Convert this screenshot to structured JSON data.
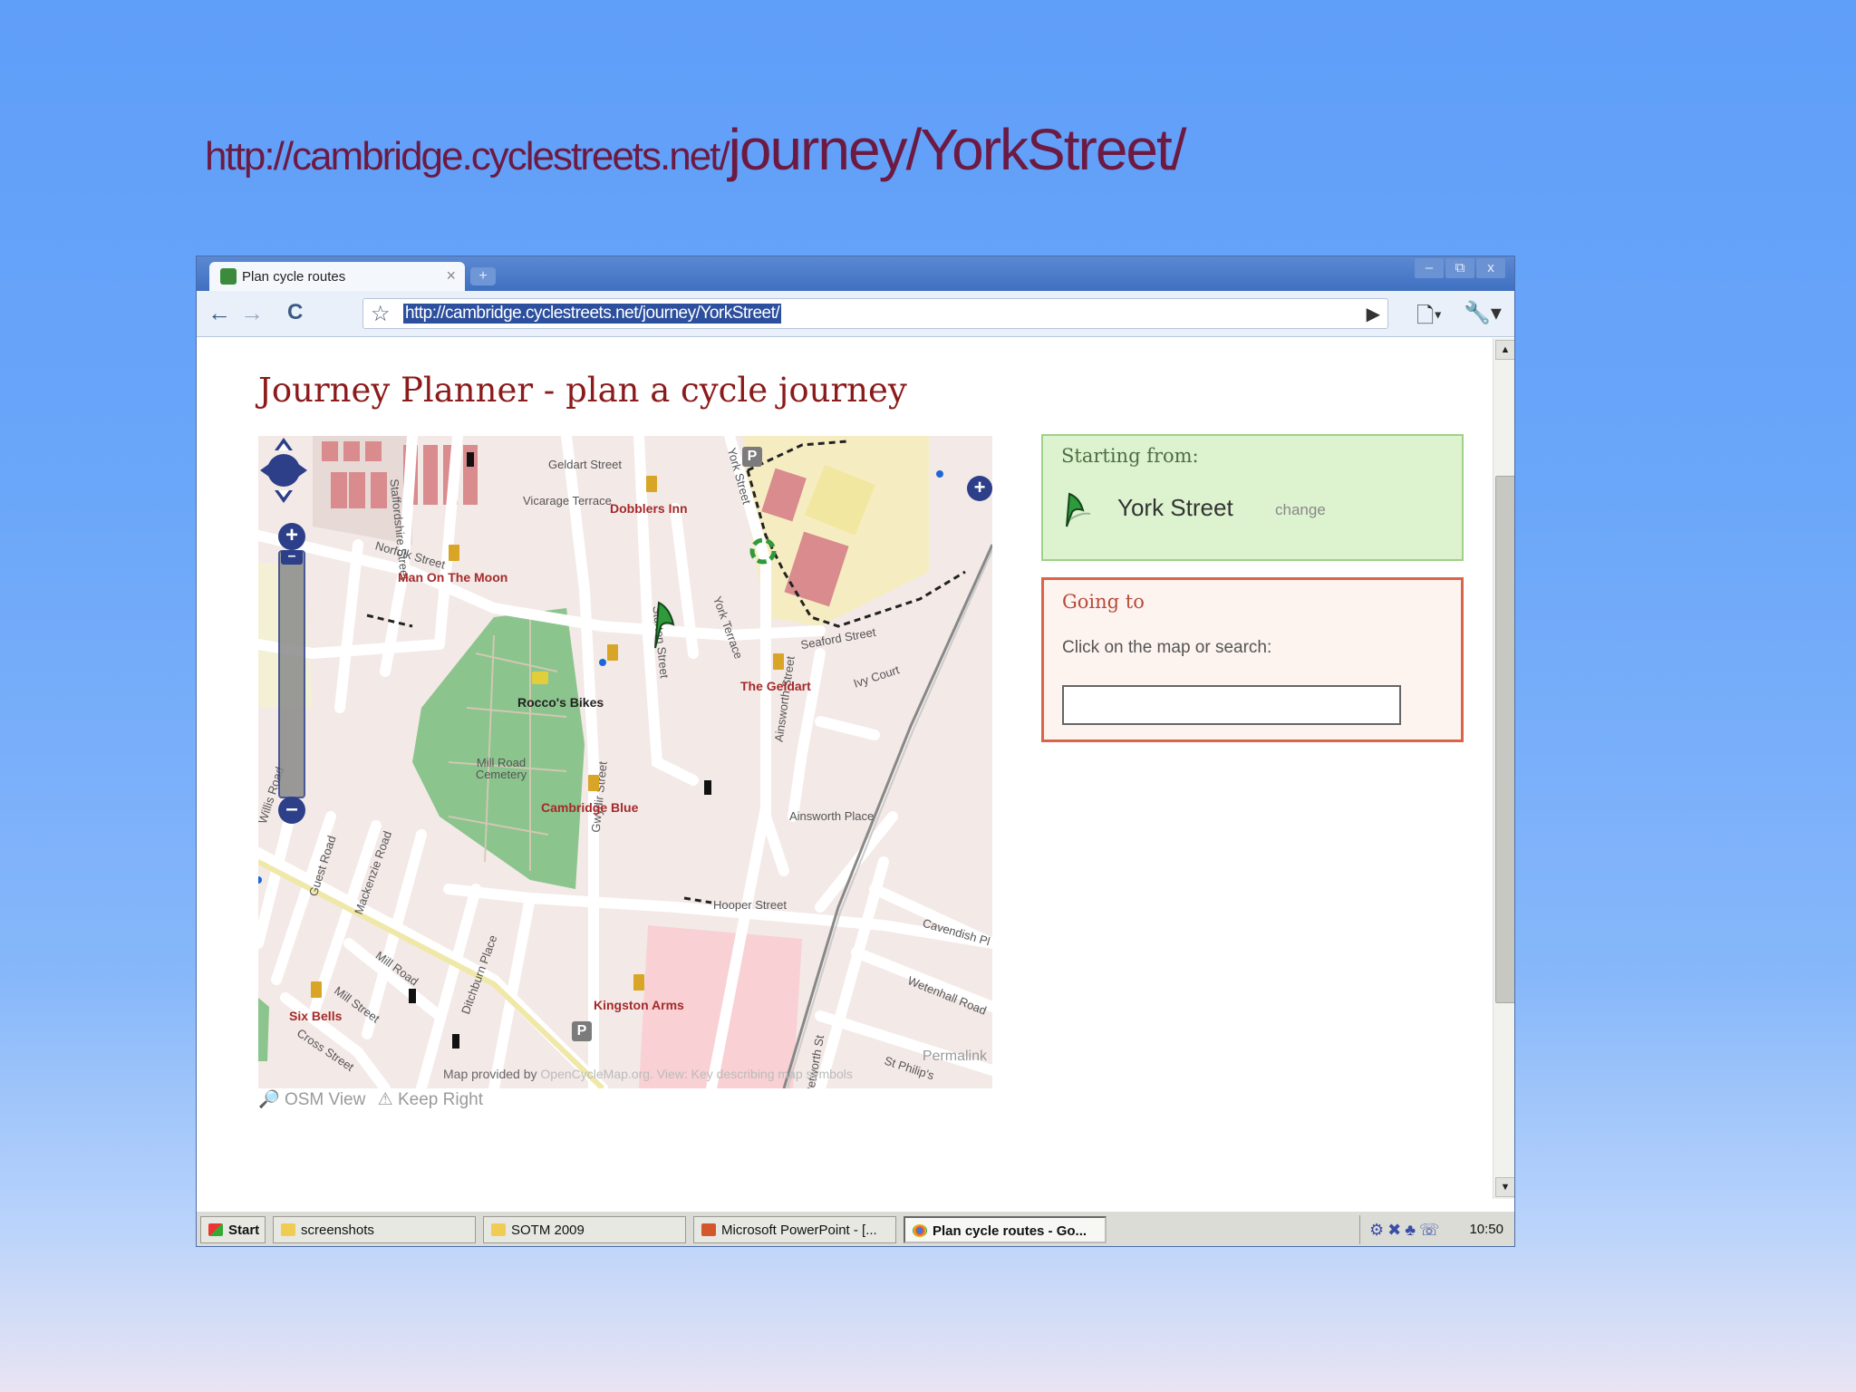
{
  "slide": {
    "title_small": "http://cambridge.cyclestreets.net/",
    "title_big": "journey/YorkStreet/"
  },
  "browser": {
    "tab_title": "Plan cycle routes",
    "tab_close": "×",
    "new_tab": "+",
    "window_buttons": [
      "–",
      "⧉",
      "x"
    ],
    "back_icon": "←",
    "forward_icon": "→",
    "reload_icon": "C",
    "star_icon": "☆",
    "url": "http://cambridge.cyclestreets.net/journey/YorkStreet/",
    "go_icon": "▶",
    "page_menu_icon": "🗋▾",
    "tools_menu_icon": "🔧▾",
    "scroll_up": "▲",
    "scroll_down": "▼"
  },
  "page": {
    "title": "Journey Planner - plan a cycle journey",
    "starting_from": {
      "heading": "Starting from:",
      "place": "York Street",
      "change_link": "change"
    },
    "going_to": {
      "heading": "Going to",
      "hint": "Click on the map or search:",
      "input_value": ""
    },
    "map": {
      "zoom_in": "+",
      "zoom_out": "–",
      "layer_switcher": "+",
      "street_labels": [
        "Geldart Street",
        "Vicarage Terrace",
        "Norfolk Street",
        "Staffordshire Street",
        "Sturton Street",
        "York Terrace",
        "York Street",
        "Seaford Street",
        "Ivy Court",
        "Ainsworth Street",
        "Ainsworth Place",
        "Hooper Street",
        "Cavendish Pl",
        "Mill Road Cemetery",
        "Gwydir Street",
        "Ditchburn Place",
        "Mill Road",
        "Mackenzie Road",
        "Guest Road",
        "Mill Street",
        "Cross Street",
        "Wetenhall Road",
        "St Philip's",
        "Willis Road",
        "Petworth St"
      ],
      "poi_labels": [
        "Dobblers Inn",
        "Man On The Moon",
        "Rocco's Bikes",
        "The Geldart",
        "Cambridge Blue",
        "Kingston Arms",
        "Six Bells"
      ],
      "permalink": "Permalink",
      "attribution_prefix": "Map provided by ",
      "attribution_link": "OpenCycleMap.org. View: Key describing map symbols",
      "osm_view": "OSM View",
      "keep_right": "Keep Right"
    }
  },
  "taskbar": {
    "start": "Start",
    "items": [
      "screenshots",
      "SOTM 2009",
      "Microsoft PowerPoint - [...",
      "Plan cycle routes - Go..."
    ],
    "tray_icons": "⚙✖♣☏",
    "clock": "10:50"
  }
}
